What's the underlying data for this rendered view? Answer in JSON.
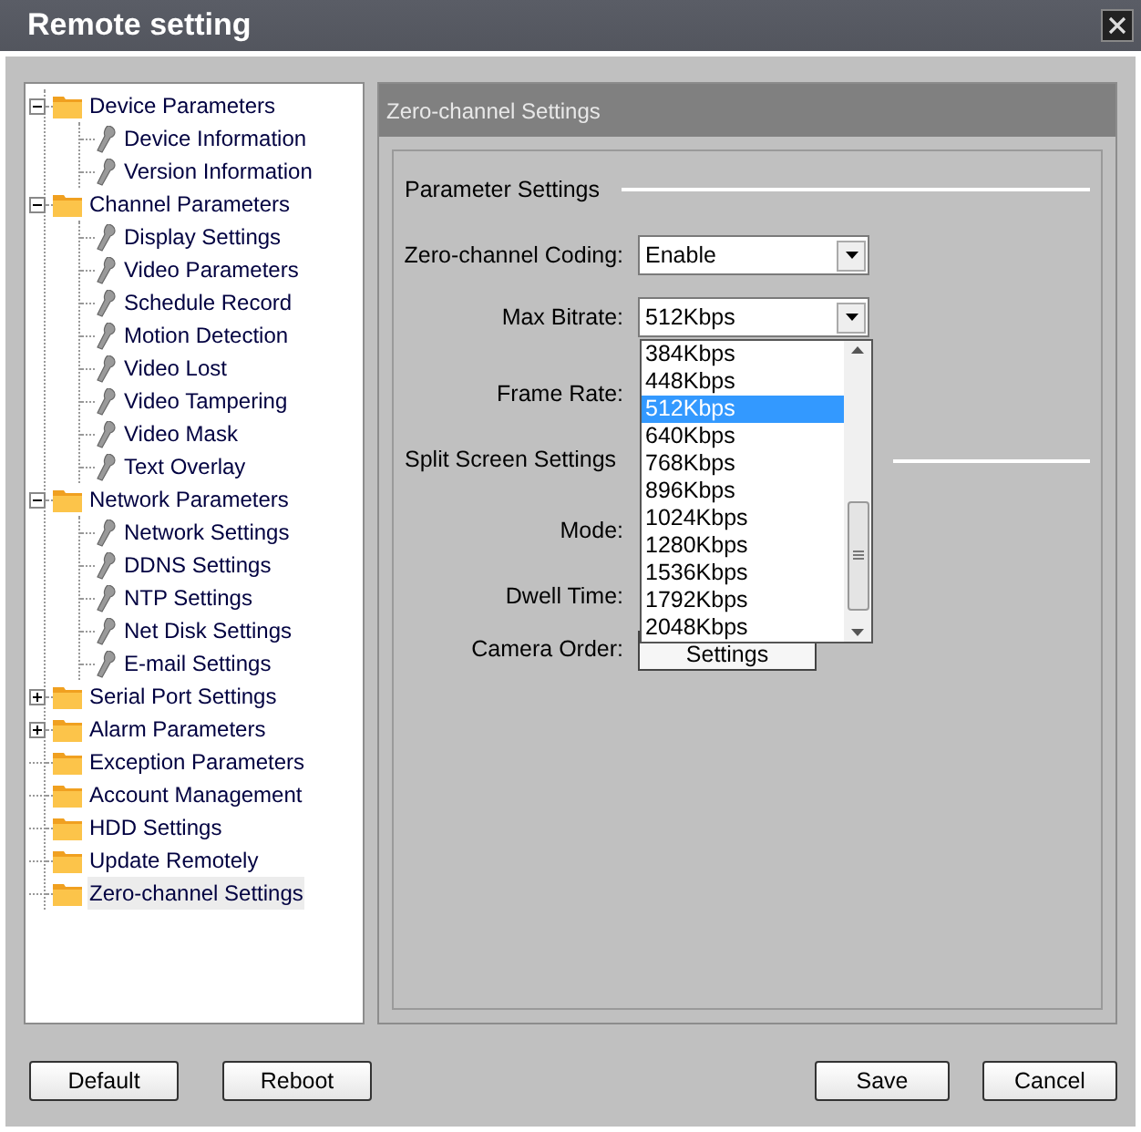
{
  "window": {
    "title": "Remote setting"
  },
  "tree": [
    {
      "label": "Device Parameters",
      "expandable": true,
      "expanded": true,
      "selected": false,
      "children": [
        {
          "label": "Device Information",
          "selected": false
        },
        {
          "label": "Version Information",
          "selected": false
        }
      ]
    },
    {
      "label": "Channel Parameters",
      "expandable": true,
      "expanded": true,
      "selected": false,
      "children": [
        {
          "label": "Display Settings",
          "selected": false
        },
        {
          "label": "Video Parameters",
          "selected": false
        },
        {
          "label": "Schedule Record",
          "selected": false
        },
        {
          "label": "Motion Detection",
          "selected": false
        },
        {
          "label": "Video Lost",
          "selected": false
        },
        {
          "label": "Video Tampering",
          "selected": false
        },
        {
          "label": "Video Mask",
          "selected": false
        },
        {
          "label": "Text Overlay",
          "selected": false
        }
      ]
    },
    {
      "label": "Network Parameters",
      "expandable": true,
      "expanded": true,
      "selected": false,
      "children": [
        {
          "label": "Network Settings",
          "selected": false
        },
        {
          "label": "DDNS Settings",
          "selected": false
        },
        {
          "label": "NTP Settings",
          "selected": false
        },
        {
          "label": "Net Disk Settings",
          "selected": false
        },
        {
          "label": "E-mail Settings",
          "selected": false
        }
      ]
    },
    {
      "label": "Serial Port Settings",
      "expandable": true,
      "expanded": false,
      "selected": false
    },
    {
      "label": "Alarm Parameters",
      "expandable": true,
      "expanded": false,
      "selected": false
    },
    {
      "label": "Exception Parameters",
      "expandable": false,
      "selected": false
    },
    {
      "label": "Account Management",
      "expandable": false,
      "selected": false
    },
    {
      "label": "HDD Settings",
      "expandable": false,
      "selected": false
    },
    {
      "label": "Update Remotely",
      "expandable": false,
      "selected": false
    },
    {
      "label": "Zero-channel Settings",
      "expandable": false,
      "selected": true
    }
  ],
  "panel": {
    "header": "Zero-channel Settings",
    "parameter_section": "Parameter Settings",
    "coding": {
      "label": "Zero-channel Coding:",
      "value": "Enable"
    },
    "bitrate": {
      "label": "Max Bitrate:",
      "value": "512Kbps",
      "options": [
        {
          "label": "384Kbps",
          "selected": false
        },
        {
          "label": "448Kbps",
          "selected": false
        },
        {
          "label": "512Kbps",
          "selected": true
        },
        {
          "label": "640Kbps",
          "selected": false
        },
        {
          "label": "768Kbps",
          "selected": false
        },
        {
          "label": "896Kbps",
          "selected": false
        },
        {
          "label": "1024Kbps",
          "selected": false
        },
        {
          "label": "1280Kbps",
          "selected": false
        },
        {
          "label": "1536Kbps",
          "selected": false
        },
        {
          "label": "1792Kbps",
          "selected": false
        },
        {
          "label": "2048Kbps",
          "selected": false
        }
      ]
    },
    "frame_rate": {
      "label": "Frame Rate:"
    },
    "split_section": "Split Screen Settings",
    "mode": {
      "label": "Mode:"
    },
    "dwell_time": {
      "label": "Dwell Time:"
    },
    "camera_order": {
      "label": "Camera Order:",
      "button": "Settings"
    }
  },
  "buttons": {
    "left": [
      "Default",
      "Reboot"
    ],
    "right": [
      "Save",
      "Cancel"
    ]
  }
}
